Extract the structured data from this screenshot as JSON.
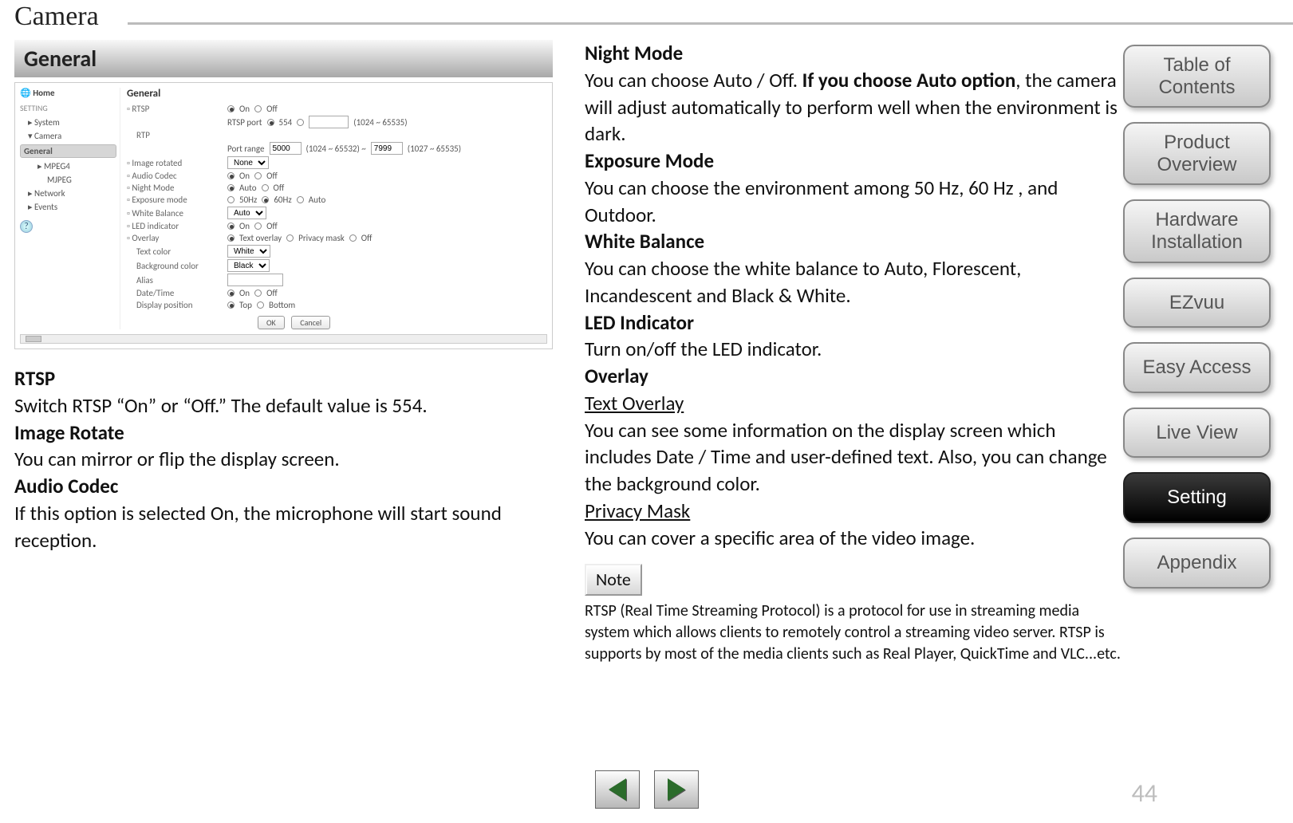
{
  "page": {
    "title": "Camera",
    "number": "44"
  },
  "section": {
    "title": "General"
  },
  "screenshot": {
    "home": "Home",
    "setting_label": "SETTING",
    "nav": {
      "system": "System",
      "camera": "Camera",
      "general": "General",
      "mpeg4": "MPEG4",
      "mjpeg": "MJPEG",
      "network": "Network",
      "events": "Events"
    },
    "form": {
      "heading": "General",
      "rtsp": {
        "label": "RTSP",
        "on": "On",
        "off": "Off"
      },
      "rtsp_port": {
        "label": "RTSP port",
        "value": "554",
        "hint": "(1024 ~ 65535)"
      },
      "rtp": {
        "label": "RTP"
      },
      "port_range": {
        "label": "Port range",
        "from": "5000",
        "hint_from": "(1024 ~ 65532) ~",
        "to": "7999",
        "hint_to": "(1027 ~ 65535)"
      },
      "image_rotated": {
        "label": "Image rotated",
        "value": "None"
      },
      "audio_codec": {
        "label": "Audio Codec",
        "on": "On",
        "off": "Off"
      },
      "night_mode": {
        "label": "Night Mode",
        "auto": "Auto",
        "off": "Off"
      },
      "exposure": {
        "label": "Exposure mode",
        "hz50": "50Hz",
        "hz60": "60Hz",
        "auto": "Auto"
      },
      "white_balance": {
        "label": "White Balance",
        "value": "Auto"
      },
      "led": {
        "label": "LED indicator",
        "on": "On",
        "off": "Off"
      },
      "overlay": {
        "label": "Overlay",
        "text": "Text overlay",
        "mask": "Privacy mask",
        "off": "Off"
      },
      "text_color": {
        "label": "Text color",
        "value": "White"
      },
      "bg_color": {
        "label": "Background color",
        "value": "Black"
      },
      "alias": {
        "label": "Alias"
      },
      "datetime": {
        "label": "Date/Time",
        "on": "On",
        "off": "Off"
      },
      "position": {
        "label": "Display position",
        "top": "Top",
        "bottom": "Bottom"
      },
      "ok": "OK",
      "cancel": "Cancel"
    }
  },
  "left": {
    "rtsp_h": "RTSP",
    "rtsp_p": "Switch RTSP “On” or “Off.” The default value is 554.",
    "rotate_h": "Image Rotate",
    "rotate_p": " You can mirror or flip the display screen.",
    "audio_h": "Audio Codec",
    "audio_p": "If this option is selected On, the microphone will start sound reception."
  },
  "right": {
    "night_h": "Night Mode",
    "night_p1": "You can choose Auto / Off. ",
    "night_b": "If you choose Auto option",
    "night_p2": ", the camera will adjust automatically to perform well when the environment is dark.",
    "exposure_h": "Exposure Mode",
    "exposure_p": "You can choose the environment among 50 Hz, 60 Hz , and Outdoor.",
    "wb_h": "White Balance",
    "wb_p": "You can choose the white balance to Auto, Florescent, Incandescent and Black & White.",
    "led_h": "LED Indicator",
    "led_p": "Turn on/off the LED indicator.",
    "overlay_h": "Overlay",
    "text_overlay_u": "Text Overlay",
    "text_overlay_p": "You can see some information on the display screen which includes Date / Time and user-defined text. Also, you can change the background color.",
    "privacy_u": "Privacy Mask",
    "privacy_p": "You can cover a specific area of the video image.",
    "note_label": "Note",
    "note_p": " RTSP (Real Time Streaming Protocol) is a protocol for use in streaming media system which allows clients to remotely control a streaming video server. RTSP is supports by most of the media clients such as Real Player, QuickTime and VLC...etc."
  },
  "nav": {
    "toc": "Table of Contents",
    "overview": "Product Overview",
    "hardware": "Hardware Installation",
    "ezvuu": "EZvuu",
    "easy": "Easy Access",
    "live": "Live View",
    "setting": "Setting",
    "appendix": "Appendix"
  }
}
